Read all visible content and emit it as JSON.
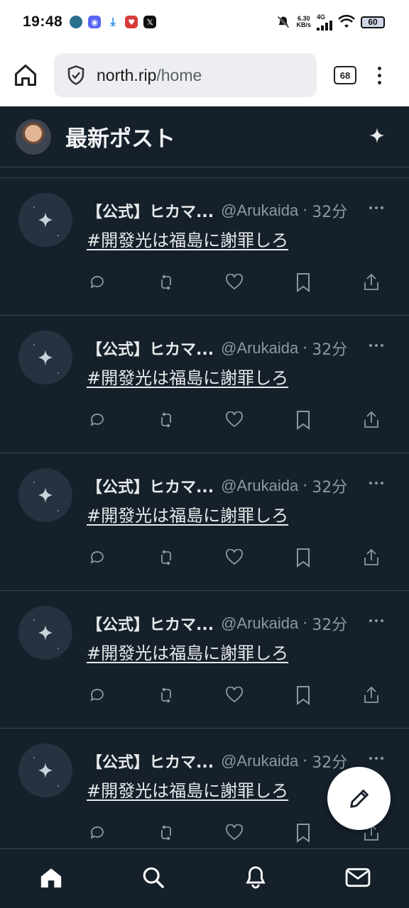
{
  "status_bar": {
    "time": "19:48",
    "net_speed_value": "6.30",
    "net_speed_unit": "KB/s",
    "net_type": "4G",
    "battery": "60",
    "app_icons": [
      "globe-app-icon",
      "discord-icon",
      "download-icon",
      "heart-app-icon",
      "x-app-icon"
    ]
  },
  "browser": {
    "url_domain": "north.rip",
    "url_path": "/home",
    "tab_count": "68"
  },
  "header": {
    "title": "最新ポスト"
  },
  "posts": [
    {
      "name": "【公式】ヒカマ...",
      "handle": "@Arukaida",
      "sep": "·",
      "time": "32分",
      "text": "#開發光は福島に謝罪しろ"
    },
    {
      "name": "【公式】ヒカマ...",
      "handle": "@Arukaida",
      "sep": "·",
      "time": "32分",
      "text": "#開發光は福島に謝罪しろ"
    },
    {
      "name": "【公式】ヒカマ...",
      "handle": "@Arukaida",
      "sep": "·",
      "time": "32分",
      "text": "#開發光は福島に謝罪しろ"
    },
    {
      "name": "【公式】ヒカマ...",
      "handle": "@Arukaida",
      "sep": "·",
      "time": "32分",
      "text": "#開發光は福島に謝罪しろ"
    },
    {
      "name": "【公式】ヒカマ...",
      "handle": "@Arukaida",
      "sep": "·",
      "time": "32分",
      "text": "#開發光は福島に謝罪しろ"
    }
  ],
  "colors": {
    "background": "#15202b",
    "border": "#38444d",
    "muted": "#8b98a5",
    "text": "#e7e9ea"
  }
}
